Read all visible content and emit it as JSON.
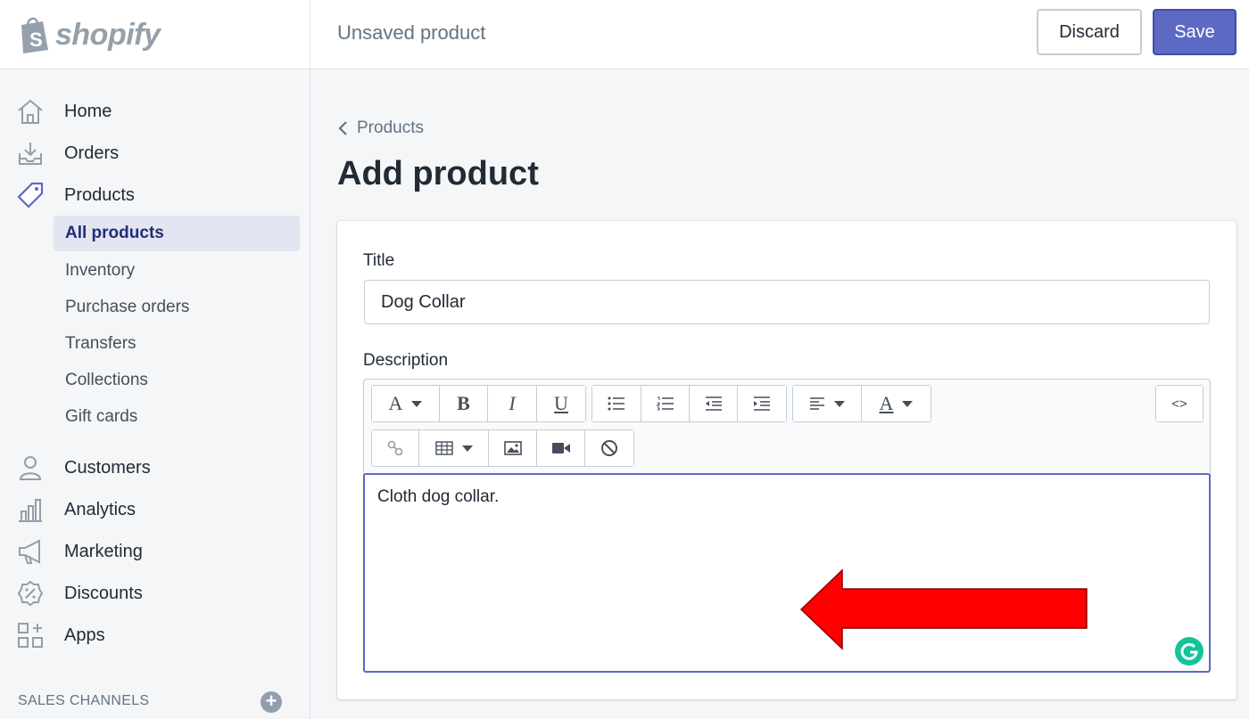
{
  "brand": {
    "name": "shopify"
  },
  "header": {
    "page_state": "Unsaved product",
    "discard_label": "Discard",
    "save_label": "Save",
    "colors": {
      "primary": "#5c6ac4"
    }
  },
  "sidebar": {
    "items": [
      {
        "label": "Home",
        "icon": "home-icon"
      },
      {
        "label": "Orders",
        "icon": "orders-icon"
      },
      {
        "label": "Products",
        "icon": "tag-icon"
      }
    ],
    "sub_items": [
      {
        "label": "All products",
        "active": true
      },
      {
        "label": "Inventory"
      },
      {
        "label": "Purchase orders"
      },
      {
        "label": "Transfers"
      },
      {
        "label": "Collections"
      },
      {
        "label": "Gift cards"
      }
    ],
    "items2": [
      {
        "label": "Customers",
        "icon": "customer-icon"
      },
      {
        "label": "Analytics",
        "icon": "analytics-icon"
      },
      {
        "label": "Marketing",
        "icon": "megaphone-icon"
      },
      {
        "label": "Discounts",
        "icon": "discount-icon"
      },
      {
        "label": "Apps",
        "icon": "apps-icon"
      }
    ],
    "section_heading": "SALES CHANNELS"
  },
  "main": {
    "breadcrumb": "Products",
    "title": "Add product",
    "form": {
      "title_label": "Title",
      "title_value": "Dog Collar",
      "description_label": "Description",
      "description_text": "Cloth dog collar.",
      "toolbar_icons": [
        "font-icon",
        "bold-icon",
        "italic-icon",
        "underline-icon",
        "bullet-list-icon",
        "numbered-list-icon",
        "outdent-icon",
        "indent-icon",
        "align-icon",
        "text-color-icon",
        "html-icon",
        "link-icon",
        "table-icon",
        "image-icon",
        "video-icon",
        "clear-format-icon"
      ],
      "toolbar_glyphs": {
        "font": "A",
        "bold": "B",
        "italic": "I",
        "underline": "U",
        "text_color": "A",
        "html": "<>"
      }
    }
  },
  "annotation": {
    "color": "#ff0000"
  }
}
